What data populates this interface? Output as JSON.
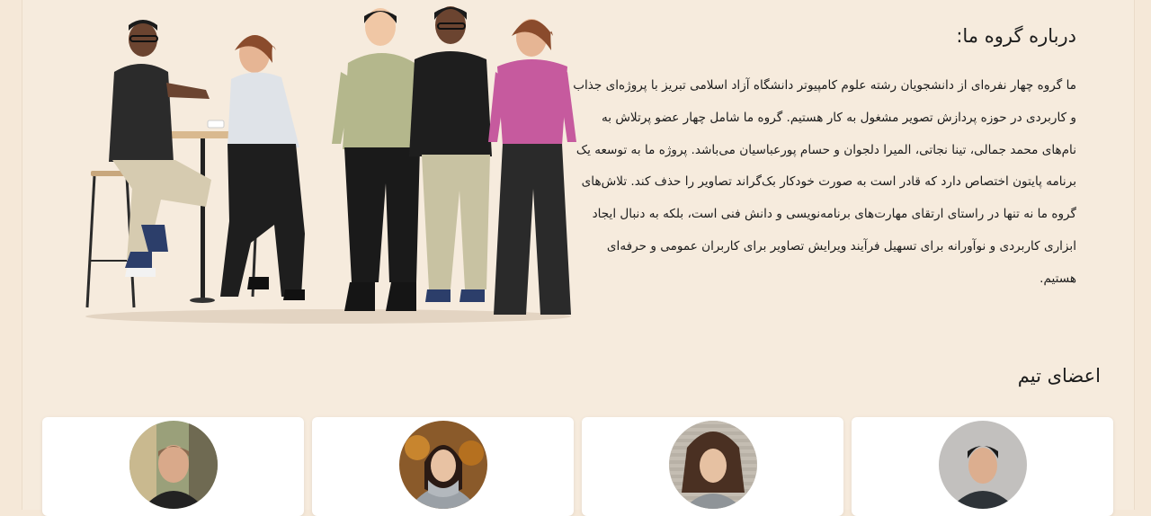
{
  "about": {
    "title": "درباره گروه ما:",
    "paragraph": "ما گروه چهار نفره‌ای از دانشجویان رشته علوم کامپیوتر دانشگاه آزاد اسلامی تبریز با پروژه‌ای جذاب و کاربردی در حوزه پردازش تصویر مشغول به کار هستیم. گروه ما شامل چهار عضو پرتلاش به نام‌های محمد جمالی، تینا نجاتی، المیرا دلجوان و حسام پورعباسیان می‌باشد. پروژه ما به توسعه یک برنامه پایتون اختصاص دارد که قادر است به صورت خودکار بک‌گراند تصاویر را حذف کند. تلاش‌های گروه ما نه تنها در راستای ارتقای مهارت‌های برنامه‌نویسی و دانش فنی است، بلکه به دنبال ایجاد ابزاری کاربردی و نوآورانه برای تسهیل فرآیند ویرایش تصاویر برای کاربران عمومی و حرفه‌ای هستیم."
  },
  "team": {
    "title": "اعضای تیم"
  },
  "colors": {
    "background": "#f6ebdd",
    "card": "#ffffff",
    "text": "#1c1c1c"
  }
}
